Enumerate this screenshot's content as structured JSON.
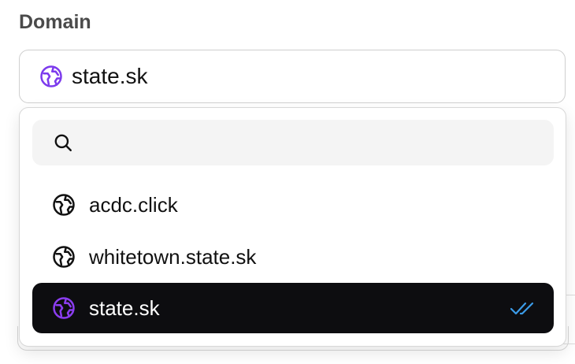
{
  "field": {
    "label": "Domain",
    "selected_value": "state.sk",
    "selected_icon": "globe-icon"
  },
  "dropdown": {
    "search": {
      "placeholder": "",
      "value": "",
      "icon": "search-icon"
    },
    "options": [
      {
        "label": "acdc.click",
        "icon": "globe-icon",
        "selected": false
      },
      {
        "label": "whitetown.state.sk",
        "icon": "globe-icon",
        "selected": false
      },
      {
        "label": "state.sk",
        "icon": "globe-icon",
        "selected": true,
        "indicator": "double-check-icon"
      }
    ]
  },
  "colors": {
    "accent_purple": "#7c3aed",
    "selected_bg": "#0d0d10",
    "check_blue": "#3b9be8",
    "label_gray": "#4a4a4a",
    "search_bg": "#f4f4f4"
  }
}
